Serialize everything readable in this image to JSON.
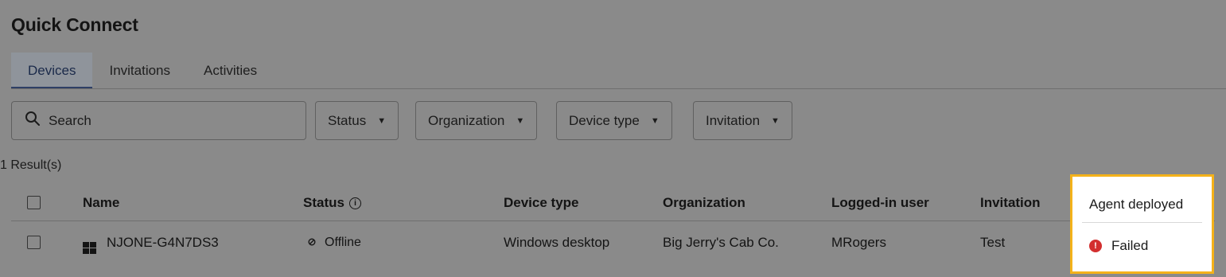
{
  "page": {
    "title": "Quick Connect"
  },
  "tabs": [
    {
      "label": "Devices",
      "active": true
    },
    {
      "label": "Invitations",
      "active": false
    },
    {
      "label": "Activities",
      "active": false
    }
  ],
  "search": {
    "label": "Search",
    "icon": "search-icon"
  },
  "filters": [
    {
      "label": "Status"
    },
    {
      "label": "Organization"
    },
    {
      "label": "Device type"
    },
    {
      "label": "Invitation"
    }
  ],
  "results": {
    "count_text": "1 Result(s)"
  },
  "table": {
    "columns": {
      "name": "Name",
      "status": "Status",
      "device_type": "Device type",
      "organization": "Organization",
      "logged_in_user": "Logged-in user",
      "invitation": "Invitation",
      "agent_deployed": "Agent deployed"
    },
    "rows": [
      {
        "name": "NJONE-G4N7DS3",
        "os_icon": "windows-icon",
        "status": "Offline",
        "status_icon": "offline-icon",
        "device_type": "Windows desktop",
        "organization": "Big Jerry's Cab Co.",
        "logged_in_user": "MRogers",
        "invitation": "Test",
        "agent_deployed": "Failed",
        "agent_deployed_icon": "error-icon"
      }
    ]
  },
  "colors": {
    "highlight_border": "#f4b21a",
    "error": "#d32f2f",
    "tab_active_text": "#1b2a4a"
  }
}
